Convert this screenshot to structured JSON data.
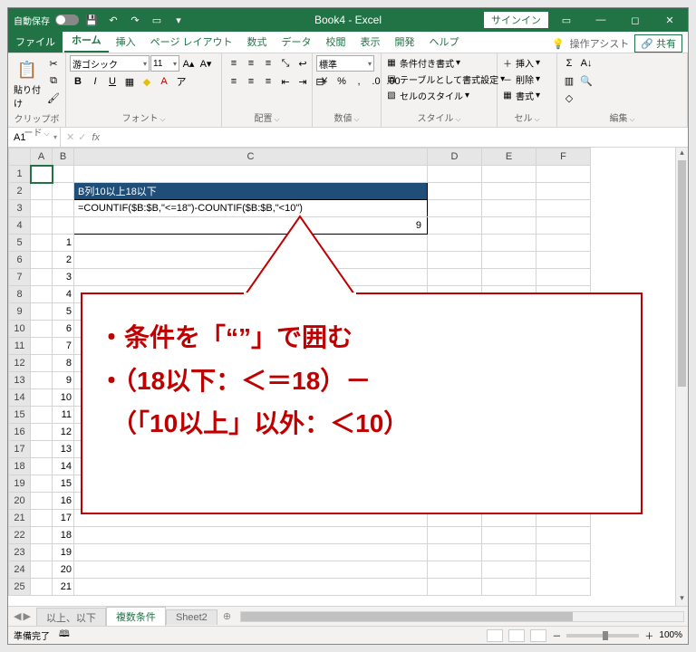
{
  "titlebar": {
    "autosave_label": "自動保存",
    "title": "Book4 - Excel",
    "signin": "サインイン"
  },
  "tabs": {
    "file": "ファイル",
    "home": "ホーム",
    "insert": "挿入",
    "page_layout": "ページ レイアウト",
    "formulas": "数式",
    "data": "データ",
    "review": "校閲",
    "view": "表示",
    "developer": "開発",
    "help": "ヘルプ",
    "tell_me": "操作アシスト",
    "share": "共有"
  },
  "ribbon": {
    "clipboard": {
      "label": "クリップボード",
      "paste": "貼り付け"
    },
    "font": {
      "label": "フォント",
      "name": "游ゴシック",
      "size": "11"
    },
    "alignment": {
      "label": "配置"
    },
    "number": {
      "label": "数値",
      "format": "標準"
    },
    "styles": {
      "label": "スタイル",
      "cond": "条件付き書式",
      "tbl": "テーブルとして書式設定",
      "cell": "セルのスタイル"
    },
    "cells": {
      "label": "セル",
      "insert": "挿入",
      "delete": "削除",
      "format": "書式"
    },
    "editing": {
      "label": "編集"
    }
  },
  "fbar": {
    "name": "A1",
    "formula": ""
  },
  "columns": [
    "A",
    "B",
    "C",
    "D",
    "E",
    "F"
  ],
  "grid": {
    "header_c2": "B列10以上18以下",
    "formula_c3": "=COUNTIF($B:$B,\"<=18\")-COUNTIF($B:$B,\"<10\")",
    "result_c4": "9",
    "b_values": [
      "1",
      "2",
      "3",
      "4",
      "5",
      "6",
      "7",
      "8",
      "9",
      "10",
      "11",
      "12",
      "13",
      "14",
      "15",
      "16",
      "17",
      "18",
      "19",
      "20",
      "21"
    ]
  },
  "callout": {
    "line1": "・条件を「“”」で囲む",
    "line2": "・（18以下：＜＝18）－",
    "line3": "　（「10以上」以外：＜10）"
  },
  "sheets": {
    "s1": "以上、以下",
    "s2": "複数条件",
    "s3": "Sheet2"
  },
  "status": {
    "ready": "準備完了",
    "acc": "🕮",
    "zoom": "100%"
  }
}
